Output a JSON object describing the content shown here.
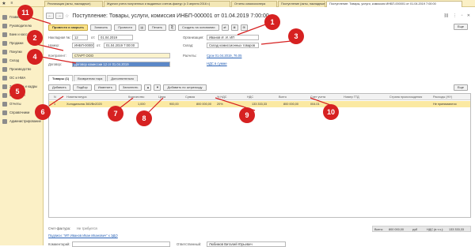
{
  "topbar": {
    "star_icon": "star-icon",
    "menu_icon": "menu-icon"
  },
  "tabs": [
    {
      "label": "Реализация (акты, накладные)"
    },
    {
      "label": "Журнал учета полученных и выданных счетов-фактур (с 3 апреля 2016 г.)"
    },
    {
      "label": "Отчеты комиссионера"
    },
    {
      "label": "Поступление (акты, накладные)"
    },
    {
      "label": "Поступление: Товары, услуги, комиссия ИНБП-000001 от 01.04.2019 7:00:00",
      "active": true
    }
  ],
  "sidebar": {
    "items": [
      {
        "label": "Главное"
      },
      {
        "label": "Руководителю"
      },
      {
        "label": "Банк и касса"
      },
      {
        "label": "Продажи"
      },
      {
        "label": "Покупки"
      },
      {
        "label": "Склад"
      },
      {
        "label": "Производство"
      },
      {
        "label": "ОС и НМА"
      },
      {
        "label": "Зарплата и кадры"
      },
      {
        "label": "Операции"
      },
      {
        "label": "Отчеты"
      },
      {
        "label": "Справочники"
      },
      {
        "label": "Администрирование"
      }
    ]
  },
  "document": {
    "title": "Поступление: Товары, услуги, комиссия ИНБП-000001 от 01.04.2019 7:00:00",
    "toolbar": {
      "post_close": "Провести и закрыть",
      "save": "Записать",
      "post": "Провести",
      "print": "Печать",
      "create_based": "Создать на основании",
      "more": "Еще"
    },
    "fields": {
      "invoice_label": "Накладная №:",
      "invoice_number": "12",
      "from_label": "от:",
      "invoice_date": "01.04.2019",
      "number_label": "Номер:",
      "number_value": "ИНБП-000001",
      "number_date": "01.04.2019 7:00:00",
      "counterparty_label": "Контрагент:",
      "counterparty_value": "СТАРТ ООО",
      "contract_label": "Договор:",
      "contract_value": "Договор комиссии 12 от 01.04.2019",
      "org_label": "Организация:",
      "org_value": "Иванов И. И. ИП",
      "warehouse_label": "Склад:",
      "warehouse_value": "Склад комиссионных товаров",
      "settlements_label": "Расчеты:",
      "settlements_link": "Срок 01.04.2019, 76.05",
      "vat_link": "НДС в сумме"
    },
    "subtabs": [
      {
        "label": "Товары (1)",
        "active": true
      },
      {
        "label": "Возвратная тара"
      },
      {
        "label": "Дополнительно"
      }
    ],
    "table_toolbar": {
      "add": "Добавить",
      "select": "Подбор",
      "change": "Изменить",
      "fill": "Заполнить",
      "barcode": "Добавить по штрихкоду",
      "more": "Еще"
    },
    "table": {
      "headers": [
        "N",
        "Номенклатура",
        "Количество",
        "Цена",
        "Сумма",
        "% НДС",
        "НДС",
        "Всего",
        "Счет учета",
        "Номер ГТД",
        "Страна происхождения",
        "Расходы (НУ)"
      ],
      "rows": [
        {
          "n": "1",
          "item": "Холодильник 360/Bn2020",
          "qty": "1,000",
          "price": "900,00",
          "sum": "800 000,00",
          "vat_rate": "20%",
          "vat": "133 333,33",
          "total": "800 000,00",
          "account": "004.01",
          "gtd": "",
          "country": "",
          "expenses": "Не принимаются"
        }
      ]
    },
    "footer": {
      "invoice_label": "Счет-фактура:",
      "invoice_value": "Не требуется",
      "signature_link": "Подписи: \"ИП Иванов Иван Иванович\" к ЭДО",
      "comment_label": "Комментарий:",
      "responsible_label": "Ответственный:",
      "responsible_value": "Любимов Виталий Юрьевич",
      "total_label": "Всего:",
      "total_value": "800 000,00",
      "currency": "руб",
      "vat_total_label": "НДС (в т.ч.):",
      "vat_total_value": "133 333,33"
    }
  },
  "callouts": [
    "1",
    "2",
    "3",
    "4",
    "5",
    "6",
    "7",
    "8",
    "9",
    "10",
    "11"
  ],
  "colors": {
    "callout": "#d62121",
    "sidebar_bg": "#fbf0c6",
    "primary_button": "#fbe38a",
    "selected_row": "#fbe9a2",
    "link": "#2962b6"
  }
}
